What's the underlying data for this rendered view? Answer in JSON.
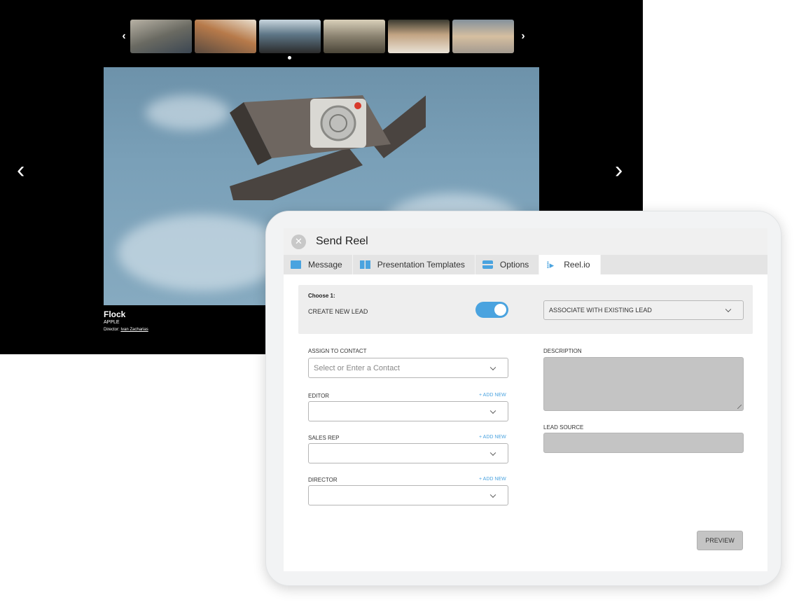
{
  "player": {
    "thumb_prev_icon": "chevron-left-icon",
    "thumb_next_icon": "chevron-right-icon",
    "thumbnails": [
      "thumb-1",
      "thumb-2",
      "thumb-3",
      "thumb-4",
      "thumb-5",
      "thumb-6"
    ],
    "active_thumbnail": 1,
    "nav_prev_icon": "chevron-left-icon",
    "nav_next_icon": "chevron-right-icon",
    "caption": {
      "title": "Flock",
      "client": "APPLE",
      "director_prefix": "Director:",
      "director_name": "Ivan Zacharias"
    }
  },
  "modal": {
    "title": "Send Reel",
    "close_icon": "close-icon",
    "tabs": [
      {
        "label": "Message",
        "icon": "mail-icon"
      },
      {
        "label": "Presentation Templates",
        "icon": "template-icon"
      },
      {
        "label": "Options",
        "icon": "options-icon"
      },
      {
        "label": "Reel.io",
        "icon": "reelio-logo-icon",
        "active": true
      }
    ],
    "choose": {
      "label": "Choose 1:",
      "create_label": "CREATE NEW LEAD",
      "toggle_on": true,
      "associate_label": "ASSOCIATE WITH EXISTING LEAD"
    },
    "fields": {
      "assign_label": "ASSIGN TO CONTACT",
      "assign_placeholder": "Select or Enter a Contact",
      "editor_label": "EDITOR",
      "sales_rep_label": "SALES REP",
      "director_label": "DIRECTOR",
      "add_new": "+ ADD NEW",
      "description_label": "DESCRIPTION",
      "lead_source_label": "LEAD SOURCE"
    },
    "preview_label": "PREVIEW"
  },
  "colors": {
    "accent": "#4aa3df",
    "player_bg": "#000000",
    "disabled_fill": "#c4c4c4"
  }
}
